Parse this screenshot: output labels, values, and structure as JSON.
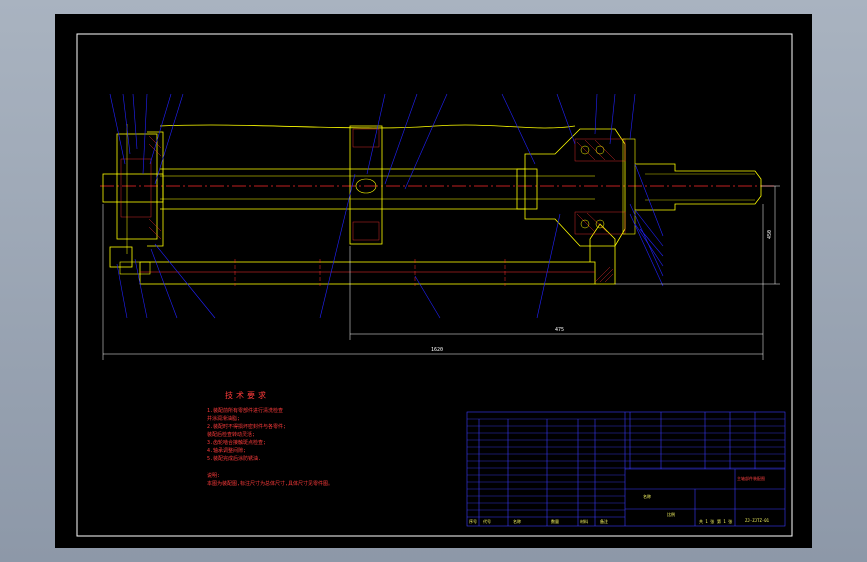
{
  "colors": {
    "background": "#9aa5b3",
    "sheet": "#000000",
    "border": "#ffffff",
    "centerline": "#ff2a2a",
    "part_outline": "#ffff00",
    "hatch": "#ff3030",
    "leader": "#2222ff",
    "dimension": "#ffffff",
    "note_text": "#ff3b3b",
    "table_line": "#3a3aff",
    "table_text": "#ffff66"
  },
  "notes": {
    "title": "技术要求",
    "lines": [
      "1.装配前所有零部件进行清洗检查",
      "  并涂润滑油脂;",
      "2.装配时不得损坏密封件与各零件;",
      "  装配后检查转动灵活;",
      "3.齿轮啮合接触斑点检查;",
      "4.轴承调整间隙;",
      "5.装配完成后涂防锈油."
    ],
    "remark_label": "说明:",
    "remark_text": "本图为装配图,标注尺寸为总体尺寸,具体尺寸见零件图。"
  },
  "dimensions": {
    "overall_length": "1620",
    "inner_length": "475",
    "height": "450"
  },
  "title_block": {
    "part_list_header": [
      "序号",
      "代号",
      "名称",
      "数量",
      "材料",
      "备注"
    ],
    "name_header": "名称",
    "scale_label": "比例",
    "sheet_info": [
      "共 1 张",
      "第 1 张"
    ],
    "drawing_no": "ZJ-ZJTZ-01",
    "drawing_title": "主轴部件装配图"
  }
}
